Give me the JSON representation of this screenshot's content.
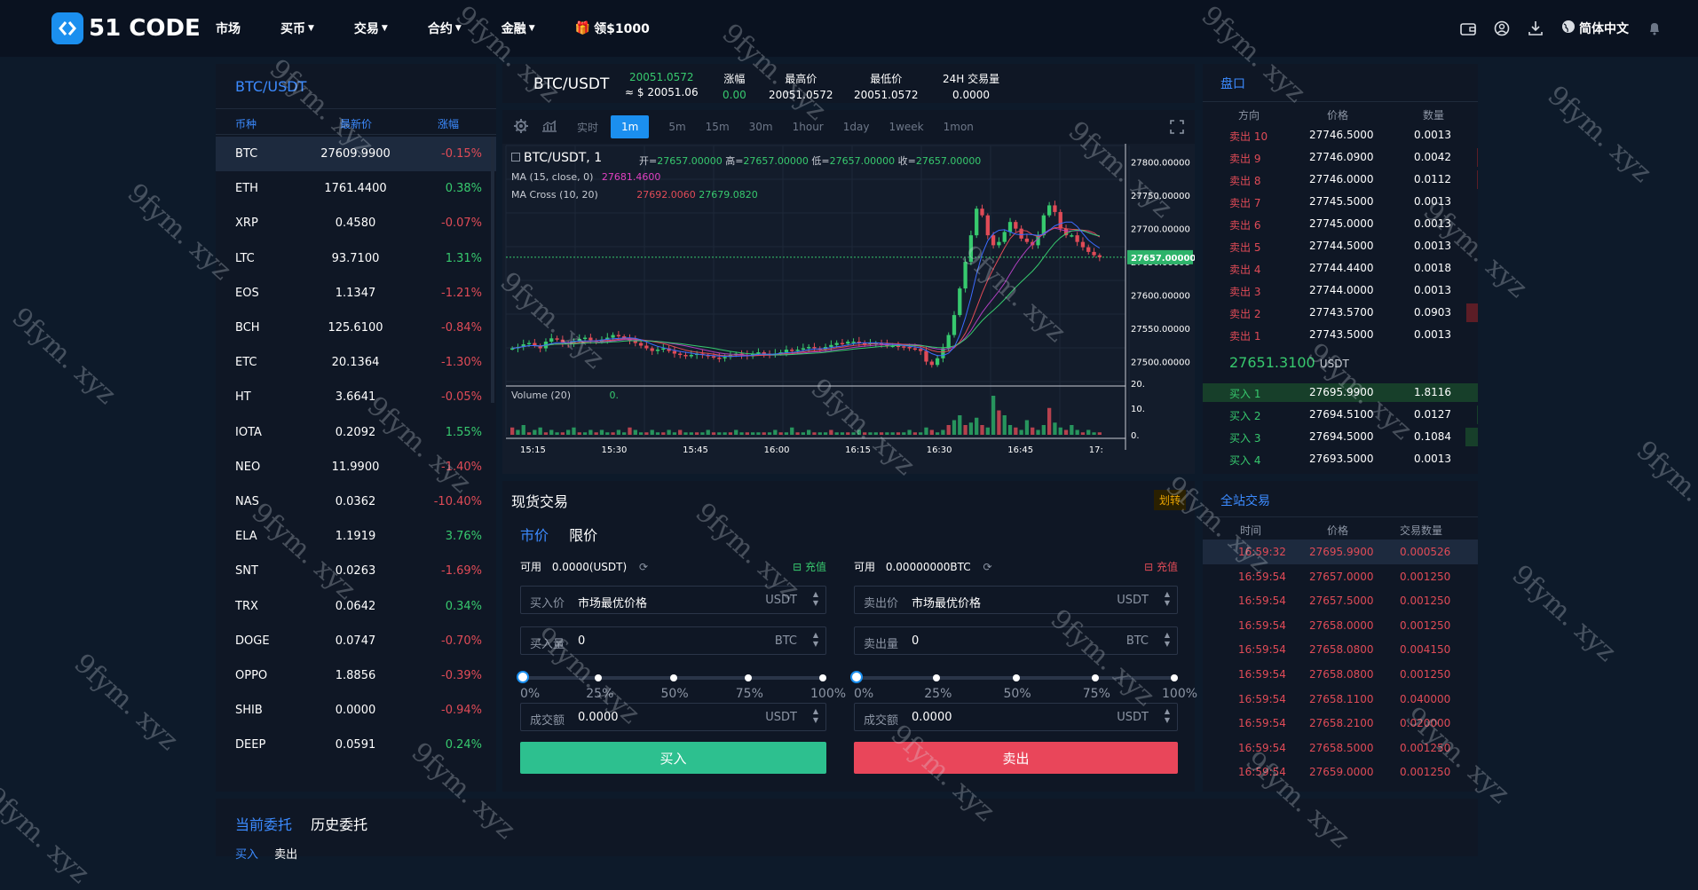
{
  "logo": {
    "text": "51 CODE"
  },
  "nav": {
    "items": [
      {
        "label": "市场",
        "caret": false
      },
      {
        "label": "买币",
        "caret": true
      },
      {
        "label": "交易",
        "caret": true
      },
      {
        "label": "合约",
        "caret": true
      },
      {
        "label": "金融",
        "caret": true
      }
    ],
    "promo": "领$1000",
    "language": "简体中文"
  },
  "market": {
    "title": "BTC/USDT",
    "headers": [
      "币种",
      "最新价",
      "涨幅"
    ],
    "rows": [
      {
        "coin": "BTC",
        "price": "27609.9900",
        "change": "-0.15%",
        "dir": "down",
        "selected": true
      },
      {
        "coin": "ETH",
        "price": "1761.4400",
        "change": "0.38%",
        "dir": "up"
      },
      {
        "coin": "XRP",
        "price": "0.4580",
        "change": "-0.07%",
        "dir": "down"
      },
      {
        "coin": "LTC",
        "price": "93.7100",
        "change": "1.31%",
        "dir": "up"
      },
      {
        "coin": "EOS",
        "price": "1.1347",
        "change": "-1.21%",
        "dir": "down"
      },
      {
        "coin": "BCH",
        "price": "125.6100",
        "change": "-0.84%",
        "dir": "down"
      },
      {
        "coin": "ETC",
        "price": "20.1364",
        "change": "-1.30%",
        "dir": "down"
      },
      {
        "coin": "HT",
        "price": "3.6641",
        "change": "-0.05%",
        "dir": "down"
      },
      {
        "coin": "IOTA",
        "price": "0.2092",
        "change": "1.55%",
        "dir": "up"
      },
      {
        "coin": "NEO",
        "price": "11.9900",
        "change": "-1.40%",
        "dir": "down"
      },
      {
        "coin": "NAS",
        "price": "0.0362",
        "change": "-10.40%",
        "dir": "down"
      },
      {
        "coin": "ELA",
        "price": "1.1919",
        "change": "3.76%",
        "dir": "up"
      },
      {
        "coin": "SNT",
        "price": "0.0263",
        "change": "-1.69%",
        "dir": "down"
      },
      {
        "coin": "TRX",
        "price": "0.0642",
        "change": "0.34%",
        "dir": "up"
      },
      {
        "coin": "DOGE",
        "price": "0.0747",
        "change": "-0.70%",
        "dir": "down"
      },
      {
        "coin": "OPPO",
        "price": "1.8856",
        "change": "-0.39%",
        "dir": "down"
      },
      {
        "coin": "SHIB",
        "price": "0.0000",
        "change": "-0.94%",
        "dir": "down"
      },
      {
        "coin": "DEEP",
        "price": "0.0591",
        "change": "0.24%",
        "dir": "up"
      }
    ]
  },
  "ticker": {
    "pair": "BTC/USDT",
    "price": "20051.0572",
    "price_usd": "≈ $ 20051.06",
    "change_label": "涨幅",
    "change": "0.00",
    "high_label": "最高价",
    "high": "20051.0572",
    "low_label": "最低价",
    "low": "20051.0572",
    "vol_label": "24H 交易量",
    "vol": "0.0000"
  },
  "chart": {
    "timeframes": [
      "实时",
      "1m",
      "5m",
      "15m",
      "30m",
      "1hour",
      "1day",
      "1week",
      "1mon"
    ],
    "active": "1m",
    "symbol": "BTC/USDT, 1",
    "ohlc": {
      "o_label": "开=",
      "o": "27657.00000",
      "h_label": "高=",
      "h": "27657.00000",
      "l_label": "低=",
      "l": "27657.00000",
      "c_label": "收=",
      "c": "27657.00000"
    },
    "ma_label": "MA (15, close, 0)",
    "ma_value": "27681.4600",
    "cross_label": "MA Cross (10, 20)",
    "cross_v1": "27692.0060",
    "cross_v2": "27679.0820",
    "volume_label": "Volume (20)",
    "volume_value": "0.",
    "last_price_tag": "27657.00000",
    "price_ticks": [
      "27800.00000",
      "27750.00000",
      "27700.00000",
      "27650.00000",
      "27600.00000",
      "27550.00000",
      "27500.00000"
    ],
    "vol_ticks": [
      "20.",
      "10.",
      "0."
    ],
    "time_ticks": [
      "15:15",
      "15:30",
      "15:45",
      "16:00",
      "16:15",
      "16:30",
      "16:45",
      "17:"
    ]
  },
  "chart_data": {
    "type": "candlestick",
    "ylim": [
      27470,
      27825
    ],
    "close_series": [
      27520,
      27522,
      27526,
      27528,
      27524,
      27520,
      27530,
      27535,
      27533,
      27528,
      27526,
      27530,
      27534,
      27536,
      27532,
      27530,
      27533,
      27536,
      27540,
      27538,
      27536,
      27532,
      27528,
      27524,
      27520,
      27516,
      27518,
      27520,
      27516,
      27512,
      27510,
      27508,
      27510,
      27512,
      27510,
      27508,
      27506,
      27505,
      27507,
      27510,
      27512,
      27510,
      27508,
      27512,
      27514,
      27512,
      27510,
      27512,
      27514,
      27518,
      27516,
      27518,
      27520,
      27522,
      27520,
      27518,
      27522,
      27525,
      27528,
      27527,
      27530,
      27530,
      27528,
      27526,
      27528,
      27528,
      27526,
      27524,
      27524,
      27523,
      27522,
      27520,
      27519,
      27516,
      27500,
      27495,
      27505,
      27520,
      27540,
      27570,
      27610,
      27650,
      27690,
      27730,
      27720,
      27690,
      27675,
      27680,
      27695,
      27710,
      27700,
      27685,
      27680,
      27675,
      27690,
      27720,
      27735,
      27725,
      27700,
      27690,
      27690,
      27680,
      27672,
      27665,
      27660,
      27657
    ],
    "volume": [
      3,
      2,
      4,
      1,
      2,
      3,
      1,
      2,
      1,
      1,
      2,
      3,
      1,
      1,
      2,
      1,
      2,
      1,
      1,
      2,
      1,
      3,
      2,
      1,
      1,
      2,
      1,
      1,
      2,
      1,
      2,
      1,
      1,
      1,
      1,
      2,
      1,
      1,
      1,
      1,
      2,
      1,
      1,
      1,
      1,
      1,
      1,
      2,
      1,
      1,
      3,
      1,
      1,
      2,
      1,
      1,
      1,
      2,
      1,
      1,
      1,
      1,
      2,
      1,
      1,
      1,
      1,
      1,
      1,
      1,
      1,
      2,
      1,
      1,
      3,
      2,
      1,
      2,
      4,
      6,
      8,
      4,
      5,
      7,
      4,
      3,
      16,
      10,
      8,
      4,
      3,
      2,
      6,
      3,
      2,
      4,
      11,
      5,
      3,
      2,
      4,
      2,
      1,
      2,
      1,
      1
    ]
  },
  "trade": {
    "tab": "现货交易",
    "transfer": "划转",
    "mode_market": "市价",
    "mode_limit": "限价",
    "available_label": "可用",
    "buy_available": "0.0000(USDT)",
    "sell_available": "0.00000000BTC",
    "recharge": "充值",
    "buy_price_label": "买入价",
    "sell_price_label": "卖出价",
    "best_price": "市场最优价格",
    "buy_qty_label": "买入量",
    "sell_qty_label": "卖出量",
    "qty_value": "0",
    "amount_label": "成交额",
    "amount_value": "0.0000",
    "unit_usdt": "USDT",
    "unit_btc": "BTC",
    "percents": [
      "0%",
      "25%",
      "50%",
      "75%",
      "100%"
    ],
    "buy_button": "买入",
    "sell_button": "卖出",
    "colors": {
      "buy": "#2dc08f",
      "sell": "#e9465a"
    }
  },
  "orderbook": {
    "title": "盘口",
    "headers": [
      "方向",
      "价格",
      "数量"
    ],
    "asks": [
      {
        "label": "卖出 10",
        "price": "27746.5000",
        "qty": "0.0013",
        "depth": 0
      },
      {
        "label": "卖出 9",
        "price": "27746.0900",
        "qty": "0.0042",
        "depth": 0.05
      },
      {
        "label": "卖出 8",
        "price": "27746.0000",
        "qty": "0.0112",
        "depth": 0.1
      },
      {
        "label": "卖出 7",
        "price": "27745.5000",
        "qty": "0.0013",
        "depth": 0
      },
      {
        "label": "卖出 6",
        "price": "27745.0000",
        "qty": "0.0013",
        "depth": 0
      },
      {
        "label": "卖出 5",
        "price": "27744.5000",
        "qty": "0.0013",
        "depth": 0
      },
      {
        "label": "卖出 4",
        "price": "27744.4400",
        "qty": "0.0018",
        "depth": 0
      },
      {
        "label": "卖出 3",
        "price": "27744.0000",
        "qty": "0.0013",
        "depth": 0
      },
      {
        "label": "卖出 2",
        "price": "27743.5700",
        "qty": "0.0903",
        "depth": 0.9
      },
      {
        "label": "卖出 1",
        "price": "27743.5000",
        "qty": "0.0013",
        "depth": 0
      }
    ],
    "mid_price": "27651.3100",
    "mid_unit": "USDT",
    "bids": [
      {
        "label": "买入 1",
        "price": "27695.9900",
        "qty": "1.8116",
        "depth": 1.0
      },
      {
        "label": "买入 2",
        "price": "27694.5100",
        "qty": "0.0127",
        "depth": 0.05
      },
      {
        "label": "买入 3",
        "price": "27694.5000",
        "qty": "0.1084",
        "depth": 0.9
      },
      {
        "label": "买入 4",
        "price": "27693.5000",
        "qty": "0.0013",
        "depth": 0
      }
    ]
  },
  "trades": {
    "title": "全站交易",
    "headers": [
      "时间",
      "价格",
      "交易数量"
    ],
    "rows": [
      {
        "time": "16:59:32",
        "price": "27695.9900",
        "qty": "0.000526",
        "selected": true
      },
      {
        "time": "16:59:54",
        "price": "27657.0000",
        "qty": "0.001250"
      },
      {
        "time": "16:59:54",
        "price": "27657.5000",
        "qty": "0.001250"
      },
      {
        "time": "16:59:54",
        "price": "27658.0000",
        "qty": "0.001250"
      },
      {
        "time": "16:59:54",
        "price": "27658.0800",
        "qty": "0.004150"
      },
      {
        "time": "16:59:54",
        "price": "27658.0800",
        "qty": "0.001250"
      },
      {
        "time": "16:59:54",
        "price": "27658.1100",
        "qty": "0.040000"
      },
      {
        "time": "16:59:54",
        "price": "27658.2100",
        "qty": "0.020000"
      },
      {
        "time": "16:59:54",
        "price": "27658.5000",
        "qty": "0.001250"
      },
      {
        "time": "16:59:54",
        "price": "27659.0000",
        "qty": "0.001250"
      }
    ]
  },
  "orders": {
    "tab_current": "当前委托",
    "tab_history": "历史委托",
    "sub_buy": "买入",
    "sub_sell": "卖出"
  },
  "watermark": "9fym. xyz"
}
